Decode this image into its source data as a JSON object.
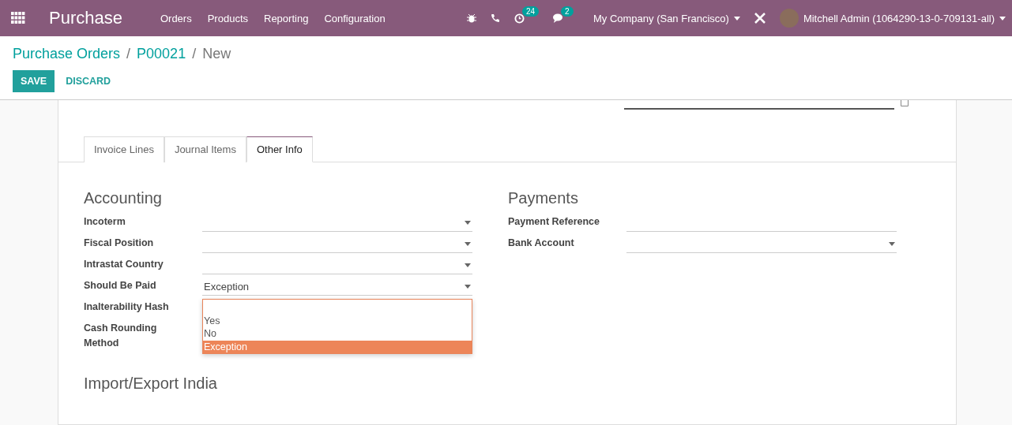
{
  "navbar": {
    "app_title": "Purchase",
    "menu": [
      {
        "label": "Orders"
      },
      {
        "label": "Products"
      },
      {
        "label": "Reporting"
      },
      {
        "label": "Configuration"
      }
    ],
    "activity_count": "24",
    "message_count": "2",
    "company": "My Company (San Francisco)",
    "user": "Mitchell Admin (1064290-13-0-709131-all)"
  },
  "breadcrumb": [
    {
      "label": "Purchase Orders",
      "link": true
    },
    {
      "label": "/",
      "link": false
    },
    {
      "label": "P00021",
      "link": true
    },
    {
      "label": "/",
      "link": false
    },
    {
      "label": "New",
      "link": false
    }
  ],
  "buttons": [
    {
      "label": "SAVE",
      "kind": "primary"
    },
    {
      "label": "DISCARD",
      "kind": "link"
    }
  ],
  "tabs": [
    {
      "label": "Invoice Lines",
      "selected": false
    },
    {
      "label": "Journal Items",
      "selected": false
    },
    {
      "label": "Other Info",
      "selected": true
    }
  ],
  "accounting": {
    "title": "Accounting",
    "fields": [
      {
        "label": "Incoterm",
        "kind": "select"
      },
      {
        "label": "Fiscal Position",
        "kind": "select"
      },
      {
        "label": "Intrastat Country",
        "kind": "select"
      },
      {
        "label": "Should Be Paid",
        "value": "Exception",
        "kind": "select"
      },
      {
        "label": "Inalterability Hash",
        "kind": "plain"
      },
      {
        "label": "Cash Rounding Method",
        "kind": "plain"
      }
    ]
  },
  "payments": {
    "title": "Payments",
    "fields": [
      {
        "label": "Payment Reference",
        "kind": "text"
      },
      {
        "label": "Bank Account",
        "kind": "select"
      }
    ]
  },
  "dropdown": {
    "options": [
      {
        "selected": false
      },
      {
        "label": "Yes",
        "selected": false
      },
      {
        "label": "No",
        "selected": false
      },
      {
        "label": "Exception",
        "selected": true
      }
    ]
  },
  "section_import": {
    "title": "Import/Export India"
  }
}
